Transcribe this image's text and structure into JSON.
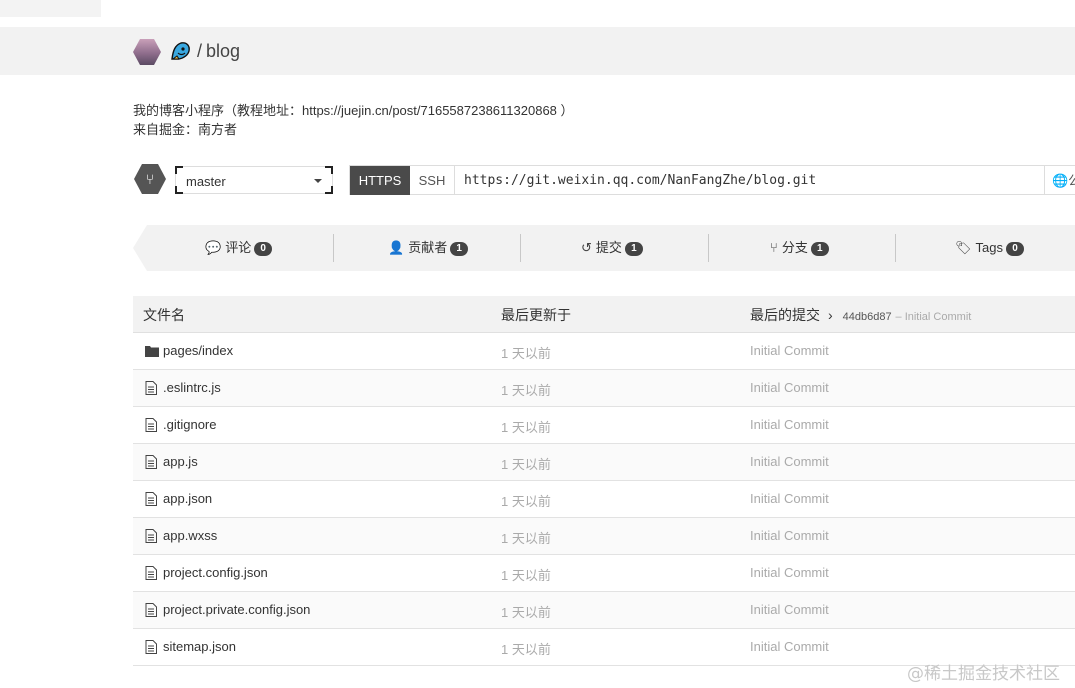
{
  "repo": {
    "owner_icon": "mascot-icon",
    "separator": "/",
    "name": "blog"
  },
  "description": {
    "line1": "我的博客小程序（教程地址：https://juejin.cn/post/7165587238611320868 ）",
    "line2": "来自掘金：南方者"
  },
  "branch": {
    "icon": "branch-icon",
    "selected": "master"
  },
  "clone": {
    "https_label": "HTTPS",
    "ssh_label": "SSH",
    "url": "https://git.weixin.qq.com/NanFangZhe/blog.git",
    "right_text": "公",
    "right_icon": "globe-icon"
  },
  "stats": [
    {
      "icon": "comment-icon",
      "label": "评论",
      "count": "0"
    },
    {
      "icon": "user-icon",
      "label": "贡献者",
      "count": "1"
    },
    {
      "icon": "history-icon",
      "label": "提交",
      "count": "1"
    },
    {
      "icon": "branch-icon",
      "label": "分支",
      "count": "1"
    },
    {
      "icon": "tag-icon",
      "label": "Tags",
      "count": "0"
    }
  ],
  "files": {
    "headers": {
      "name": "文件名",
      "updated": "最后更新于",
      "commit": "最后的提交",
      "commit_hash": "44db6d87",
      "commit_message": "– Initial Commit"
    },
    "rows": [
      {
        "type": "folder",
        "name": "pages/index",
        "time": "1 天以前",
        "message": "Initial Commit"
      },
      {
        "type": "file",
        "name": ".eslintrc.js",
        "time": "1 天以前",
        "message": "Initial Commit"
      },
      {
        "type": "file",
        "name": ".gitignore",
        "time": "1 天以前",
        "message": "Initial Commit"
      },
      {
        "type": "file",
        "name": "app.js",
        "time": "1 天以前",
        "message": "Initial Commit"
      },
      {
        "type": "file",
        "name": "app.json",
        "time": "1 天以前",
        "message": "Initial Commit"
      },
      {
        "type": "file",
        "name": "app.wxss",
        "time": "1 天以前",
        "message": "Initial Commit"
      },
      {
        "type": "file",
        "name": "project.config.json",
        "time": "1 天以前",
        "message": "Initial Commit"
      },
      {
        "type": "file",
        "name": "project.private.config.json",
        "time": "1 天以前",
        "message": "Initial Commit"
      },
      {
        "type": "file",
        "name": "sitemap.json",
        "time": "1 天以前",
        "message": "Initial Commit"
      }
    ]
  },
  "watermark": "@稀土掘金技术社区"
}
